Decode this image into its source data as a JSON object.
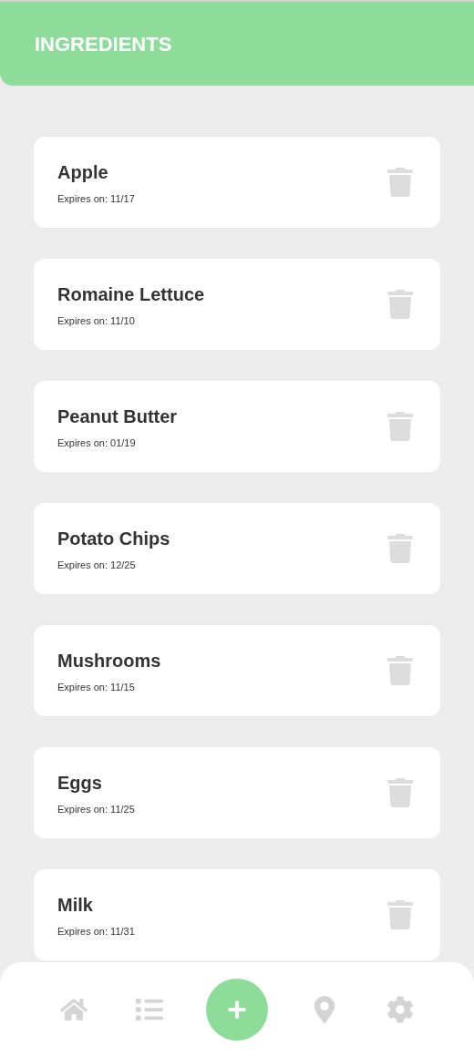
{
  "header": {
    "title": "INGREDIENTS"
  },
  "ingredients": [
    {
      "name": "Apple",
      "expires": "Expires on: 11/17"
    },
    {
      "name": "Romaine Lettuce",
      "expires": "Expires on: 11/10"
    },
    {
      "name": "Peanut Butter",
      "expires": "Expires on: 01/19"
    },
    {
      "name": "Potato Chips",
      "expires": "Expires on: 12/25"
    },
    {
      "name": "Mushrooms",
      "expires": "Expires on: 11/15"
    },
    {
      "name": "Eggs",
      "expires": "Expires on: 11/25"
    },
    {
      "name": "Milk",
      "expires": "Expires on: 11/31"
    }
  ],
  "nav": [
    {
      "kind": "home"
    },
    {
      "kind": "list"
    },
    {
      "kind": "add"
    },
    {
      "kind": "location"
    },
    {
      "kind": "settings"
    }
  ]
}
